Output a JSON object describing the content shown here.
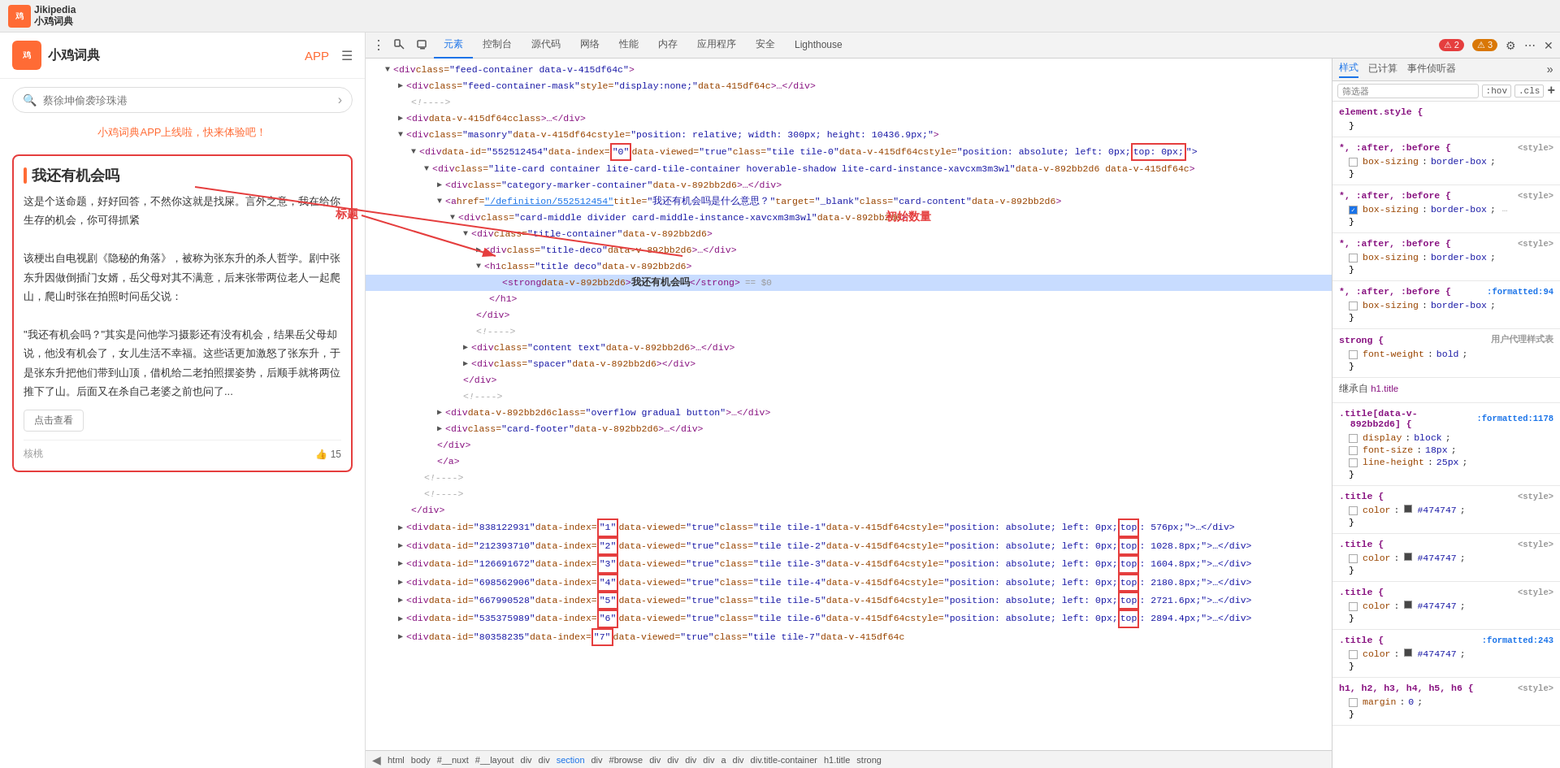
{
  "browser": {
    "logo_line1": "Jikipedia",
    "logo_line2": "小鸡词典"
  },
  "site": {
    "logo_label": "小鸡",
    "logo_title": "Jikipedia\n小鸡词典",
    "nav_app": "APP",
    "search_placeholder": "蔡徐坤偷袭珍珠港",
    "promo": "小鸡词典APP上线啦，快来体验吧！",
    "card_title": "我还有机会吗",
    "card_body_p1": "这是个送命题，好好回答，不然你这就是找屎。言外之意，我在给你生存的机会，你可得抓紧",
    "card_body_p2": "该梗出自电视剧《隐秘的角落》，被称为张东升的杀人哲学。剧中张东升因做倒插门女婿，岳父母对其不满意，后来张带两位老人一起爬山，爬山时张在拍照时问岳父说：",
    "card_body_p3": "\"我还有机会吗？\"其实是问他学习摄影还有没有机会，结果岳父母却说，他没有机会了，女儿生活不幸福。这些话更加激怒了张东升，于是张东升把他们带到山顶，借机给二老拍照摆姿势，后顺手就将两位推下了山。后面又在杀自己老婆之前也问了...",
    "read_more": "点击查看",
    "card_author": "核桃",
    "card_likes": "15"
  },
  "devtools": {
    "tabs": [
      "元素",
      "控制台",
      "源代码",
      "网络",
      "性能",
      "内存",
      "应用程序",
      "安全",
      "Lighthouse"
    ],
    "active_tab": "元素",
    "error_count": "2",
    "warn_count": "3",
    "styles_tabs": [
      "样式",
      "已计算",
      "事件侦听器"
    ],
    "styles_active": "样式",
    "filter_placeholder": "筛选器",
    "filter_pseudo": ":hov",
    "filter_cls": ".cls",
    "add_rule": "+",
    "annotation_title": "标题",
    "annotation_count": "初始数量"
  },
  "html_lines": [
    {
      "indent": 1,
      "content": "<div class=\"feed-container data-v-415df64c\">",
      "type": "tag"
    },
    {
      "indent": 2,
      "content": "<div class=\"feed-container-mask\" style=\"display:none;\" data-415df64c>…</div>",
      "type": "tag"
    },
    {
      "indent": 2,
      "content": "<!—-->",
      "type": "comment"
    },
    {
      "indent": 2,
      "content": "<div data-v-415df64c class>…</div>",
      "type": "tag"
    },
    {
      "indent": 2,
      "content": "<div class=\"masonry\" data-v-415df64c style=\"position: relative; width: 300px; height: 10436.9px;\">",
      "type": "tag"
    },
    {
      "indent": 3,
      "content": "<div data-id=\"552512454\" data-index=\"0\" data-viewed=\"true\" class=\"tile tile-0\" data-v-415df64c style=\"position: absolute; left: 0px; top: 0px;\">",
      "type": "tag",
      "highlight_0": true,
      "highlight_top": true
    },
    {
      "indent": 4,
      "content": "<div class=\"lite-card container lite-card-tile-container hoverable-shadow lite-card-instance-xavcxm3m3wl\" data-v-892bb2d6 data-v-415df64c>",
      "type": "tag"
    },
    {
      "indent": 5,
      "content": "<div class=\"category-marker-container\" data-v-892bb2d6>…</div>",
      "type": "tag"
    },
    {
      "indent": 5,
      "content": "<a href=\"/definition/552512454\" title=\"我还有机会吗是什么意思？\" target=\"_blank\" class=\"card-content\" data-v-892bb2d6>",
      "type": "tag"
    },
    {
      "indent": 6,
      "content": "<div class=\"card-middle divider card-middle-instance-xavcxm3m3wl\" data-v-892bb2d6>",
      "type": "tag"
    },
    {
      "indent": 7,
      "content": "<div class=\"title-container\" data-v-892bb2d6>",
      "type": "tag"
    },
    {
      "indent": 8,
      "content": "<div class=\"title-deco\" data-v-892bb2d6>…</div>",
      "type": "tag"
    },
    {
      "indent": 8,
      "content": "<h1 class=\"title deco\" data-v-892bb2d6>",
      "type": "tag"
    },
    {
      "indent": 9,
      "content": "<strong data-v-892bb2d6>我还有机会吗</strong>",
      "type": "selected",
      "strong_text": "我还有机会吗"
    },
    {
      "indent": 8,
      "content": "</h1>",
      "type": "tag"
    },
    {
      "indent": 7,
      "content": "</div>",
      "type": "tag"
    },
    {
      "indent": 7,
      "content": "<!—-->",
      "type": "comment"
    },
    {
      "indent": 7,
      "content": "<div class=\"content text\" data-v-892bb2d6>…</div>",
      "type": "tag"
    },
    {
      "indent": 7,
      "content": "<div class=\"spacer\" data-v-892bb2d6></div>",
      "type": "tag"
    },
    {
      "indent": 6,
      "content": "</div>",
      "type": "tag"
    },
    {
      "indent": 6,
      "content": "<!—-->",
      "type": "comment"
    },
    {
      "indent": 5,
      "content": "<div data-v-892bb2d6 class=\"overflow gradual button\">…</div>",
      "type": "tag"
    },
    {
      "indent": 5,
      "content": "<div class=\"card-footer\" data-v-892bb2d6>…</div>",
      "type": "tag"
    },
    {
      "indent": 4,
      "content": "</div>",
      "type": "tag"
    },
    {
      "indent": 4,
      "content": "</a>",
      "type": "tag"
    },
    {
      "indent": 3,
      "content": "<!—-->",
      "type": "comment"
    },
    {
      "indent": 3,
      "content": "<!—-->",
      "type": "comment"
    },
    {
      "indent": 2,
      "content": "</div>",
      "type": "tag"
    },
    {
      "indent": 2,
      "content": "<div data-id=\"838122931\" data-index=\"1\" data-viewed=\"true\" class=\"tile tile-1\" data-v-415df64c style=\"position: absolute; left: 0px; top: 576px;\">…</div>",
      "type": "tag",
      "highlight_1": true
    },
    {
      "indent": 2,
      "content": "<div data-id=\"212393710\" data-index=\"2\" data-viewed=\"true\" class=\"tile tile-2\" data-v-415df64c style=\"position: absolute; left: 0px; top: 1028.8px;\">…</div>",
      "type": "tag",
      "highlight_2": true
    },
    {
      "indent": 2,
      "content": "<div data-id=\"126691672\" data-index=\"3\" data-viewed=\"true\" class=\"tile tile-3\" data-v-415df64c style=\"position: absolute; left: 0px; top: 1604.8px;\">…</div>",
      "type": "tag",
      "highlight_3": true
    },
    {
      "indent": 2,
      "content": "<div data-id=\"698562906\" data-index=\"4\" data-viewed=\"true\" class=\"tile tile-4\" data-v-415df64c style=\"position: absolute; left: 0px; top: 2180.8px;\">…</div>",
      "type": "tag",
      "highlight_4": true
    },
    {
      "indent": 2,
      "content": "<div data-id=\"667990528\" data-index=\"5\" data-viewed=\"true\" class=\"tile tile-5\" data-v-415df64c style=\"position: absolute; left: 0px; top: 2721.6px;\">…</div>",
      "type": "tag",
      "highlight_5": true
    },
    {
      "indent": 2,
      "content": "<div data-id=\"535375989\" data-index=\"6\" data-viewed=\"true\" class=\"tile tile-6\" data-v-415df64c style=\"position: absolute; left: 0px; top: 2894.4px;\">…</div>",
      "type": "tag",
      "highlight_6": true
    },
    {
      "indent": 2,
      "content": "<div data-id=\"80358235\" data-index=\"7\" data-viewed=\"true\" class=\"tile tile-7\" data-v-415df64c",
      "type": "tag",
      "partial": true
    }
  ],
  "styles_sections": [
    {
      "selector": "element.style {",
      "source": "",
      "props": [],
      "close": "}"
    },
    {
      "selector": "*, :after, :before {",
      "source": "<style>",
      "props": [
        {
          "name": "box-sizing",
          "value": "border-box",
          "checked": false
        }
      ],
      "close": "}"
    },
    {
      "selector": "*, :after, :before {",
      "source": "<style>",
      "props": [
        {
          "name": "box-sizing",
          "value": "border-box",
          "checked": true
        }
      ],
      "close": "}",
      "has_ellipsis": true
    },
    {
      "selector": "*, :after, :before {",
      "source": "<style>",
      "props": [
        {
          "name": "box-sizing",
          "value": "border-box",
          "checked": false
        }
      ],
      "close": "}"
    },
    {
      "selector": "*, :after, :before {",
      "source": ":formatted:94",
      "source_blue": true,
      "props": [
        {
          "name": "box-sizing",
          "value": "border-box",
          "checked": false
        }
      ],
      "close": "}"
    },
    {
      "selector": "strong {",
      "source": "用户代理样式表",
      "props": [
        {
          "name": "font-weight",
          "value": "bold",
          "checked": false
        }
      ],
      "close": "}"
    },
    {
      "selector": "继承自 h1.title",
      "source": "",
      "is_inherit": true,
      "props": []
    },
    {
      "selector": ".title[data-v-892bb2d6] {",
      "source": ":formatted:1178",
      "source_blue": true,
      "props": [
        {
          "name": "display",
          "value": "block",
          "checked": false
        },
        {
          "name": "font-size",
          "value": "18px",
          "checked": false
        },
        {
          "name": "line-height",
          "value": "25px",
          "checked": false
        }
      ],
      "close": "}"
    },
    {
      "selector": ".title {",
      "source": "<style>",
      "props": [
        {
          "name": "color",
          "value": "■ #474747",
          "checked": false
        }
      ],
      "close": "}"
    },
    {
      "selector": ".title {",
      "source": "<style>",
      "props": [
        {
          "name": "color",
          "value": "■ #474747",
          "checked": false
        }
      ],
      "close": "}"
    },
    {
      "selector": ".title {",
      "source": "<style>",
      "props": [
        {
          "name": "color",
          "value": "■ #474747",
          "checked": false
        }
      ],
      "close": "}"
    },
    {
      "selector": ".title {",
      "source": ":formatted:243",
      "source_blue": true,
      "props": [
        {
          "name": "color",
          "value": "■ #474747",
          "checked": false
        }
      ],
      "close": "}"
    },
    {
      "selector": "h1, h2, h3, h4, h5, h6 {",
      "source": "<style>",
      "props": [
        {
          "name": "margin",
          "value": "0",
          "checked": false
        }
      ],
      "close": "}"
    }
  ],
  "breadcrumb": [
    "html",
    "body",
    "#__nuxt",
    "#__layout",
    "div",
    "div",
    "section",
    "div",
    "#browse",
    "div",
    "div",
    "div",
    "div",
    "a",
    "div",
    "div.title-container",
    "h1.title",
    "strong"
  ]
}
